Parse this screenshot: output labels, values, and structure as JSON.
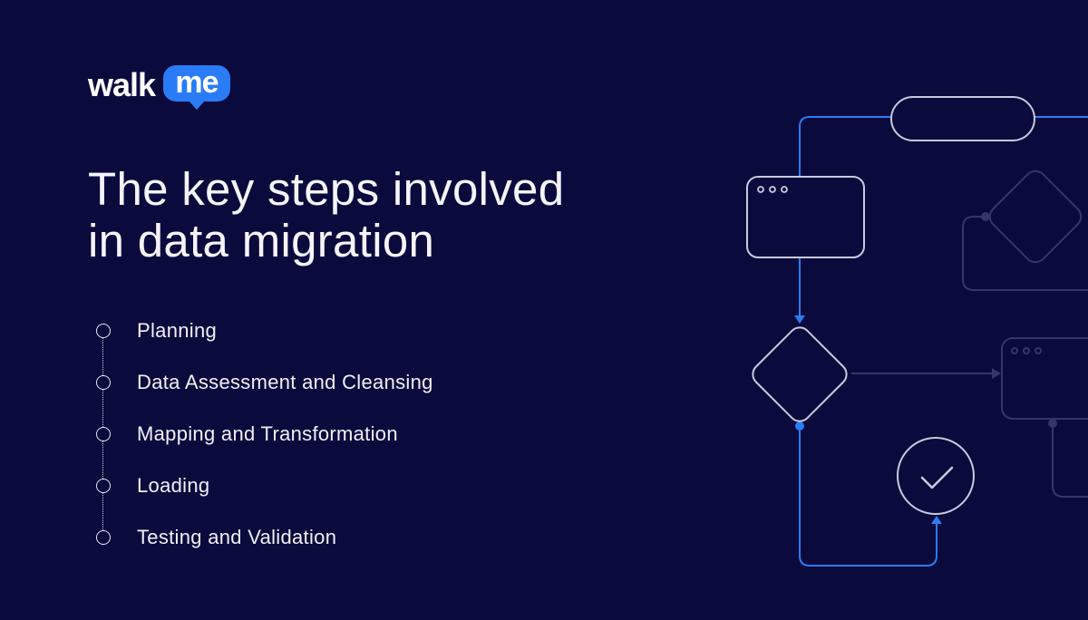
{
  "brand": {
    "logo_part1": "walk",
    "logo_part2": "me",
    "accent_color": "#2a7cf6",
    "background_color": "#0b0a3d"
  },
  "title": {
    "line1": "The key steps involved",
    "line2": "in data migration"
  },
  "steps": [
    {
      "label": "Planning"
    },
    {
      "label": "Data Assessment and Cleansing"
    },
    {
      "label": "Mapping and Transformation"
    },
    {
      "label": "Loading"
    },
    {
      "label": "Testing and Validation"
    }
  ],
  "diagram": {
    "icons": [
      "pill-node",
      "window-node",
      "diamond-decision-node",
      "check-circle-node",
      "faded-window-node",
      "faded-diamond-node"
    ],
    "colors": {
      "flow_line": "#2a7cf6",
      "node_stroke": "#c9c9dd",
      "faded_stroke": "#34366a"
    }
  }
}
